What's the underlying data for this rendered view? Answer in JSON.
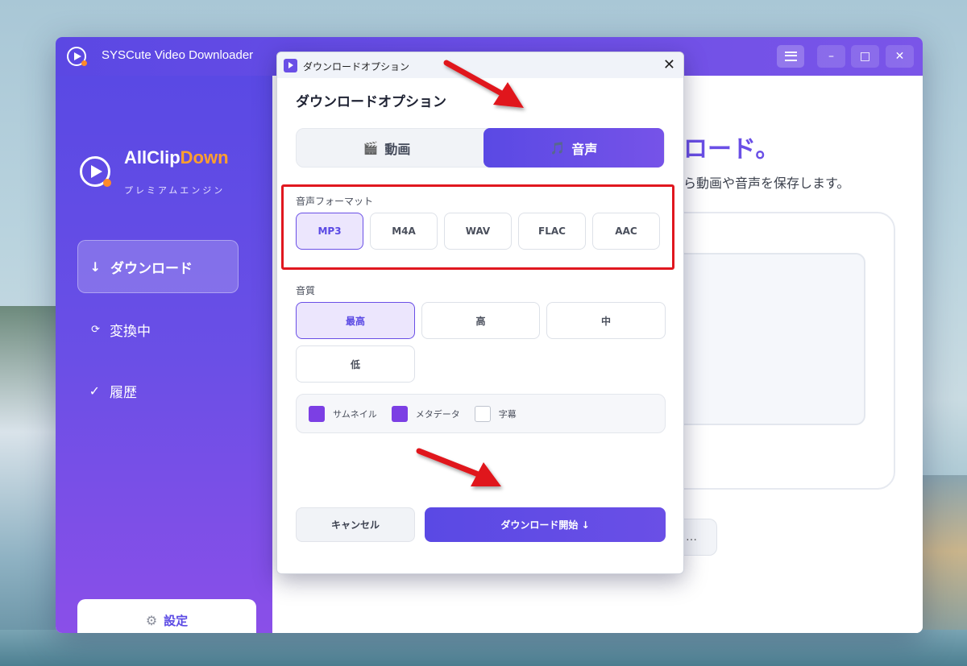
{
  "window": {
    "title": "SYSCute Video Downloader"
  },
  "brand": {
    "name_part1": "AllClip",
    "name_part2": "Down",
    "subtitle": "プレミアムエンジン"
  },
  "sidebar": {
    "items": [
      {
        "icon": "↓",
        "label": "ダウンロード"
      },
      {
        "icon": "⟳",
        "label": "変換中"
      },
      {
        "icon": "✓",
        "label": "履歴"
      }
    ],
    "settings_label": "設定"
  },
  "main": {
    "heading_fragment": "ロード。",
    "desc_fragment": "ら動画や音声を保存します。",
    "button_fragment": "…"
  },
  "dialog": {
    "window_title": "ダウンロードオプション",
    "heading": "ダウンロードオプション",
    "tabs": {
      "video": "動画",
      "audio": "音声"
    },
    "format_label": "音声フォーマット",
    "formats": [
      "MP3",
      "M4A",
      "WAV",
      "FLAC",
      "AAC"
    ],
    "selected_format": "MP3",
    "quality_label": "音質",
    "qualities": [
      "最高",
      "高",
      "中",
      "低"
    ],
    "selected_quality": "最高",
    "checks": [
      {
        "label": "サムネイル",
        "checked": true
      },
      {
        "label": "メタデータ",
        "checked": true
      },
      {
        "label": "字幕",
        "checked": false
      }
    ],
    "cancel_label": "キャンセル",
    "start_label": "ダウンロード開始 ↓"
  },
  "colors": {
    "accent": "#6a4fe6",
    "brand_orange": "#ff9f2e",
    "annotation_red": "#e0171f"
  }
}
